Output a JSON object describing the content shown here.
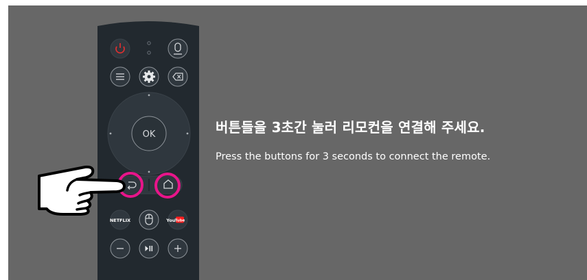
{
  "prompt": {
    "title": "버튼들을 3초간 눌러 리모컨을 연결해 주세요.",
    "subtitle": "Press the buttons for 3 seconds to connect the remote."
  },
  "remote": {
    "ok_label": "OK",
    "netflix_label": "NETFLIX",
    "youtube_label_you": "You",
    "youtube_label_tube": "Tube"
  },
  "colors": {
    "background": "#676767",
    "remote_body": "#22292f",
    "button_fill": "#2f373e",
    "button_stroke": "#8d9399",
    "power_red": "#e42f2f",
    "highlight_ring": "#e8158a",
    "youtube_red": "#ff1e1e"
  },
  "icons": [
    "power-icon",
    "assistant-icon",
    "mic-indicator",
    "menu-icon",
    "settings-icon",
    "backspace-icon",
    "back-icon",
    "home-icon",
    "mouse-icon",
    "volume-down-icon",
    "play-pause-icon",
    "volume-up-icon",
    "pointing-hand-icon"
  ]
}
